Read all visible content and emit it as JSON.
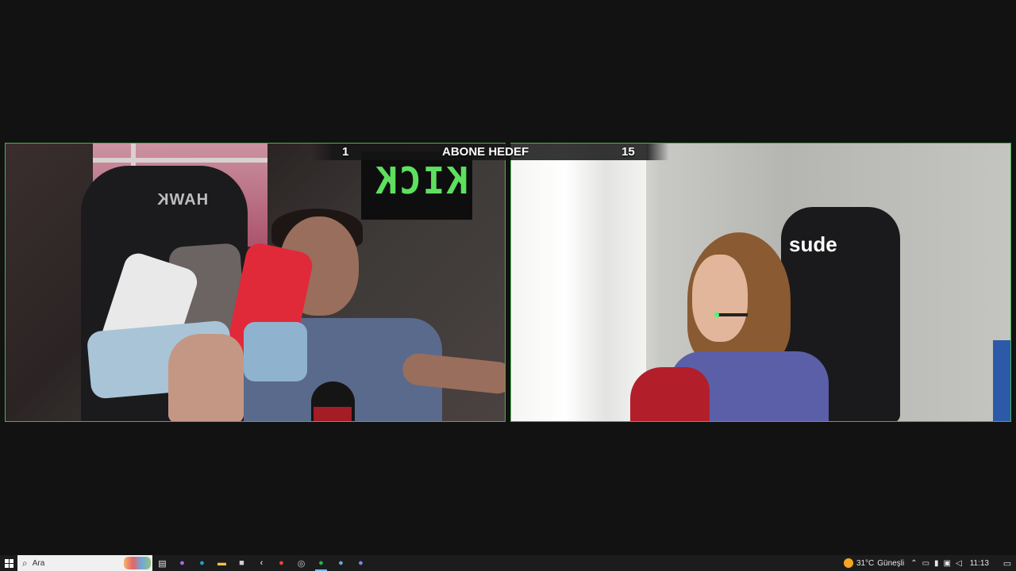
{
  "stream": {
    "goal_overlay": {
      "current": "1",
      "title": "ABONE HEDEF",
      "target": "15"
    },
    "left_cam": {
      "chair_brand": "HAWK",
      "tv_text": "KICK"
    },
    "right_cam": {
      "chair_name": "sude"
    },
    "frame_color": "#4caf50"
  },
  "taskbar": {
    "search_placeholder": "Ara",
    "start_icon": "windows-logo-icon",
    "pinned_apps": [
      {
        "name": "task-view-icon",
        "glyph": "▤",
        "color": "#e6e6e6"
      },
      {
        "name": "copilot-icon",
        "glyph": "●",
        "color": "#a66cff"
      },
      {
        "name": "edge-icon",
        "glyph": "●",
        "color": "#1fa0d8"
      },
      {
        "name": "file-explorer-icon",
        "glyph": "▬",
        "color": "#f3c34b"
      },
      {
        "name": "store-icon",
        "glyph": "■",
        "color": "#cfcfcf"
      },
      {
        "name": "app-icon",
        "glyph": "‹",
        "color": "#ffffff"
      },
      {
        "name": "chrome-icon",
        "glyph": "●",
        "color": "#e8453c"
      },
      {
        "name": "obs-icon",
        "glyph": "◎",
        "color": "#d0d0d0"
      },
      {
        "name": "spotify-icon",
        "glyph": "●",
        "color": "#1db954"
      },
      {
        "name": "steam-icon",
        "glyph": "●",
        "color": "#6aa6d6"
      },
      {
        "name": "discord-icon",
        "glyph": "●",
        "color": "#7b83ff"
      }
    ],
    "weather": {
      "temp": "31°C",
      "condition": "Güneşli"
    },
    "tray_icons": [
      "chevron-up-icon",
      "display-icon",
      "microphone-icon",
      "network-icon",
      "volume-icon"
    ],
    "time": "11:13"
  }
}
